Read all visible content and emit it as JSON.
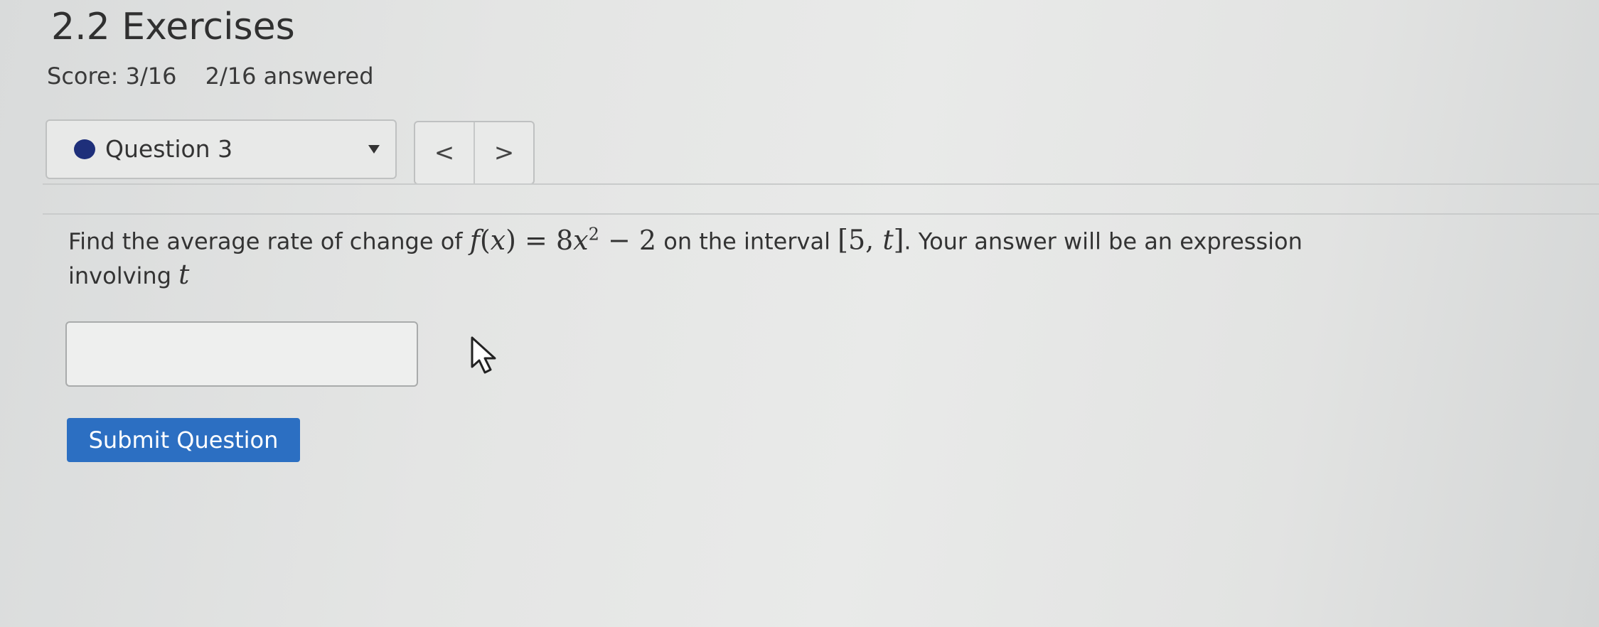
{
  "header": {
    "title": "2.2 Exercises",
    "score": "Score: 3/16",
    "answered": "2/16 answered"
  },
  "question_nav": {
    "selected": "Question 3",
    "prev_label": "<",
    "next_label": ">",
    "status_color": "#1e2f7a"
  },
  "question": {
    "text_before": "Find the average rate of change of ",
    "function": {
      "name": "f",
      "var": "x",
      "eq": "=",
      "coef": "8",
      "var2": "x",
      "exp": "2",
      "minus": "−",
      "const": "2"
    },
    "text_middle": " on the interval ",
    "interval": {
      "open": "[",
      "a": "5",
      "sep": ", ",
      "b": "t",
      "close": "]"
    },
    "text_after": ". Your answer will be an expression involving ",
    "variable": "t"
  },
  "answer": {
    "value": "",
    "placeholder": ""
  },
  "submit": {
    "label": "Submit Question",
    "color": "#2c6fc2"
  },
  "icons": {
    "status": "filled-circle-icon",
    "dropdown": "caret-down-icon",
    "cursor": "mouse-pointer-icon"
  }
}
